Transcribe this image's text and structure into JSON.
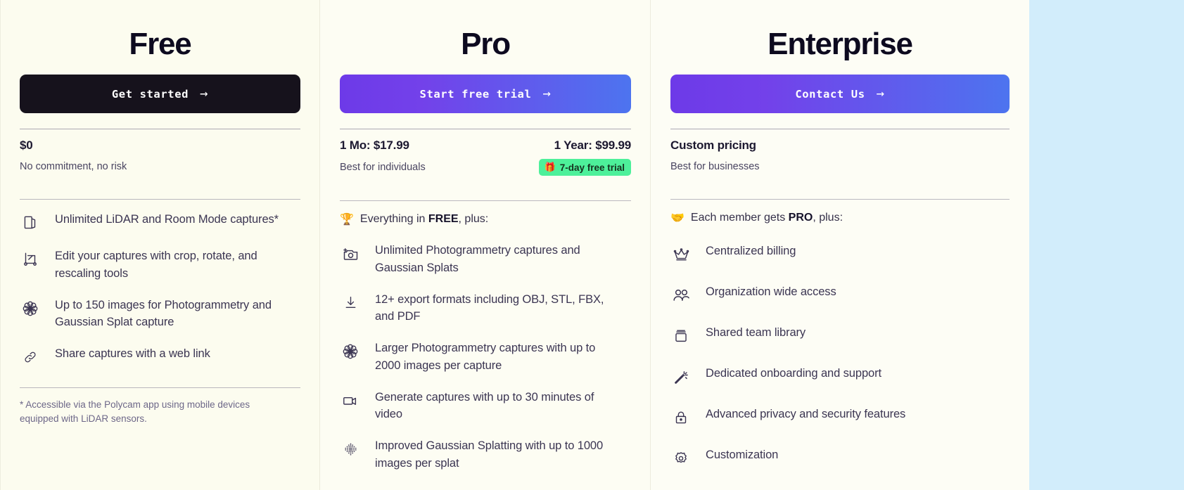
{
  "theme": {
    "page_bg": "#fdfdf0",
    "right_panel_bg": "#d2edfb",
    "dark_button_bg": "#16121c",
    "gradient_from": "#6d3ae8",
    "gradient_to": "#4d74ef",
    "badge_bg": "#4df09a",
    "text_color": "#3b3552",
    "heading_color": "#0d0a1f"
  },
  "plans": [
    {
      "id": "free",
      "title": "Free",
      "cta_label": "Get started",
      "cta_arrow": "→",
      "price_main": "$0",
      "price_secondary": "",
      "price_sub": "No commitment, no risk",
      "badge": null,
      "feature_head": null,
      "features": [
        {
          "icon": "cube-icon",
          "text": "Unlimited LiDAR and Room Mode captures*"
        },
        {
          "icon": "crop-icon",
          "text": "Edit your captures with crop, rotate, and rescaling tools"
        },
        {
          "icon": "splat-flower-icon",
          "text": "Up to 150 images for Photogrammetry and Gaussian Splat capture"
        },
        {
          "icon": "link-icon",
          "text": "Share captures with a web link"
        }
      ],
      "footnote": "* Accessible via the Polycam app using mobile devices equipped with LiDAR sensors."
    },
    {
      "id": "pro",
      "title": "Pro",
      "cta_label": "Start free trial",
      "cta_arrow": "→",
      "price_main": "1 Mo: $17.99",
      "price_secondary": "1 Year: $99.99",
      "price_sub": "Best for individuals",
      "badge": {
        "emoji": "🎁",
        "label": "7-day free trial"
      },
      "feature_head": {
        "emoji": "🏆",
        "prefix": "Everything in ",
        "bold": "FREE",
        "suffix": ", plus:"
      },
      "features": [
        {
          "icon": "camera-plus-icon",
          "text": "Unlimited Photogrammetry captures and Gaussian Splats"
        },
        {
          "icon": "download-icon",
          "text": "12+ export formats including OBJ, STL, FBX, and PDF"
        },
        {
          "icon": "splat-flower-icon",
          "text": "Larger Photogrammetry captures with up to 2000 images per capture"
        },
        {
          "icon": "video-camera-icon",
          "text": "Generate captures with up to 30 minutes of video"
        },
        {
          "icon": "point-cloud-icon",
          "text": "Improved Gaussian Splatting with up to 1000 images per splat"
        }
      ],
      "footnote": null
    },
    {
      "id": "enterprise",
      "title": "Enterprise",
      "cta_label": "Contact Us",
      "cta_arrow": "→",
      "price_main": "Custom pricing",
      "price_secondary": "",
      "price_sub": "Best for businesses",
      "badge": null,
      "feature_head": {
        "emoji": "🤝",
        "prefix": "Each member gets ",
        "bold": "PRO",
        "suffix": ", plus:"
      },
      "features": [
        {
          "icon": "crown-icon",
          "text": "Centralized billing"
        },
        {
          "icon": "people-icon",
          "text": "Organization wide access"
        },
        {
          "icon": "archive-box-icon",
          "text": "Shared team library"
        },
        {
          "icon": "magic-wand-icon",
          "text": "Dedicated onboarding and support"
        },
        {
          "icon": "lock-icon",
          "text": "Advanced privacy and security features"
        },
        {
          "icon": "gear-icon",
          "text": "Customization"
        }
      ],
      "footnote": null
    }
  ]
}
